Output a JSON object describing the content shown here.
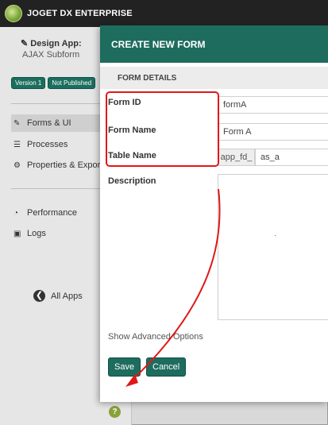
{
  "app": {
    "brand": "JOGET DX ENTERPRISE"
  },
  "sidebar": {
    "title": "Design App:",
    "app_name": "AJAX Subform",
    "version": "Version 1",
    "status": "Not Published",
    "nav": [
      {
        "label": "Forms & UI",
        "icon": "edit-icon"
      },
      {
        "label": "Processes",
        "icon": "list-icon"
      },
      {
        "label": "Properties & Export",
        "icon": "gear-icon"
      },
      {
        "label": "Performance",
        "icon": "dashboard-icon"
      },
      {
        "label": "Logs",
        "icon": "logs-icon"
      }
    ],
    "all_apps": "All Apps",
    "help": "?"
  },
  "modal": {
    "title": "CREATE NEW FORM",
    "section": "FORM DETAILS",
    "form_id_label": "Form ID",
    "form_id_value": "formA",
    "form_name_label": "Form Name",
    "form_name_value": "Form A",
    "table_name_label": "Table Name",
    "table_prefix": "app_fd_",
    "table_name_value": "as_a",
    "description_label": "Description",
    "advanced": "Show Advanced Options",
    "save": "Save",
    "cancel": "Cancel"
  },
  "colors": {
    "brand_green": "#1e6c5e",
    "annotation_red": "#e01818",
    "topbar": "#222222"
  }
}
